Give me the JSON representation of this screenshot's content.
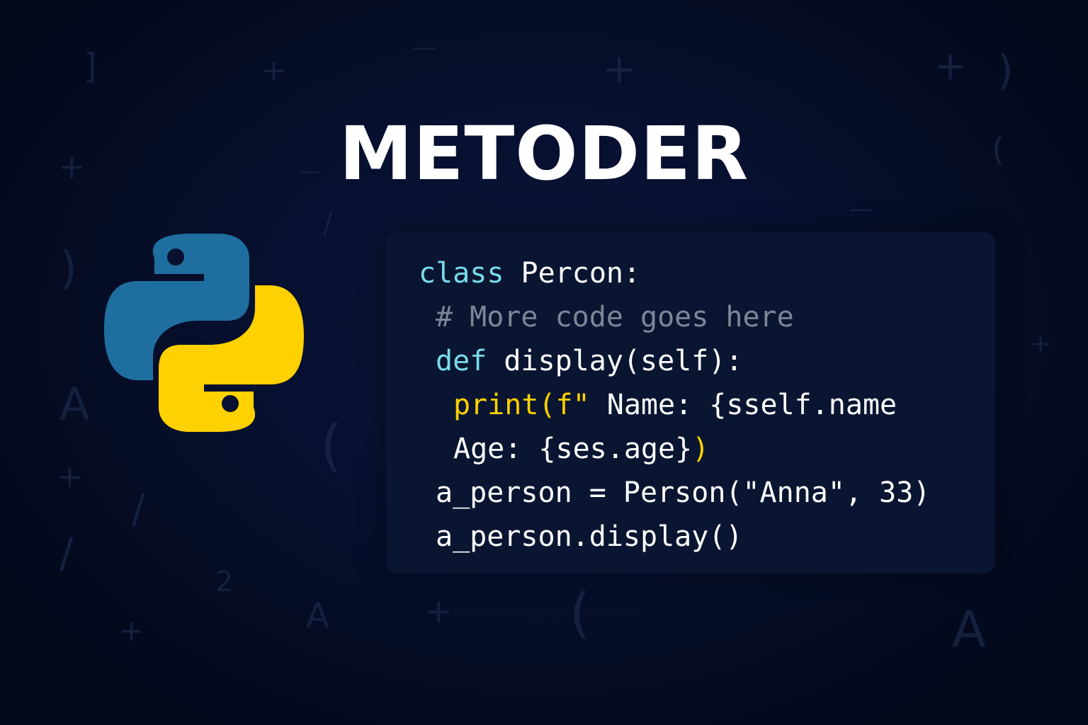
{
  "title": "METODER",
  "logo": {
    "name": "python-logo",
    "colors": {
      "blue": "#1e6f9f",
      "yellow": "#ffd100",
      "eye": "#071030"
    }
  },
  "code": {
    "lines": [
      {
        "tokens": [
          {
            "text": "class",
            "role": "kw"
          },
          {
            "text": " Percon:",
            "role": "plain"
          }
        ]
      },
      {
        "tokens": [
          {
            "text": "# More code goes here",
            "role": "comment"
          }
        ]
      },
      {
        "tokens": [
          {
            "text": "def",
            "role": "kw"
          },
          {
            "text": " display(self):",
            "role": "plain"
          }
        ]
      },
      {
        "tokens": [
          {
            "text": "print(f\"",
            "role": "yellow"
          },
          {
            "text": " Name: {sself.name",
            "role": "plain"
          }
        ]
      },
      {
        "tokens": [
          {
            "text": "Age: {ses.age}",
            "role": "plain"
          },
          {
            "text": ")",
            "role": "yellow"
          }
        ]
      },
      {
        "tokens": [
          {
            "text": "a_person = Person(\"Anna\", 33)",
            "role": "plain"
          }
        ]
      },
      {
        "tokens": [
          {
            "text": "a_person.display()",
            "role": "plain"
          }
        ]
      }
    ]
  },
  "background_glyphs": [
    "]",
    "+",
    "—",
    "+",
    "+",
    ")",
    "+",
    "—",
    "(",
    ")",
    "/",
    "—",
    "+",
    "A",
    "(",
    "+",
    "/",
    "/",
    "2",
    "A",
    "+",
    "(",
    "+",
    "A",
    "+"
  ],
  "colors": {
    "background": "#050b20",
    "panel": "#0a1532",
    "keyword": "#78dcea",
    "comment": "#7d8597",
    "accent_yellow": "#ffd100",
    "text": "#ffffff"
  }
}
